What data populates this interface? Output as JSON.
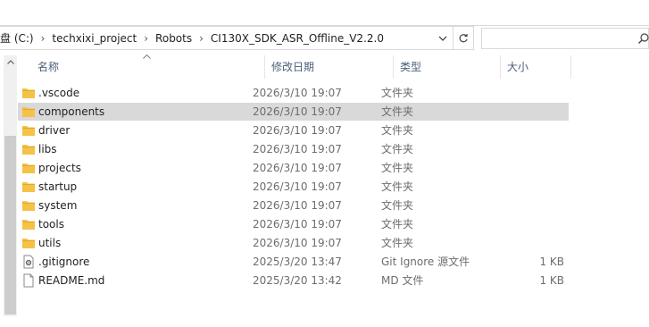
{
  "address": {
    "crumbs": [
      "盘 (C:)",
      "techxixi_project",
      "Robots",
      "CI130X_SDK_ASR_Offline_V2.2.0"
    ],
    "separator": "›"
  },
  "columns": {
    "name": "名称",
    "date": "修改日期",
    "type": "类型",
    "size": "大小"
  },
  "files": [
    {
      "name": ".vscode",
      "date": "2026/3/10 19:07",
      "type": "文件夹",
      "size": "",
      "icon": "folder-icon",
      "selected": false
    },
    {
      "name": "components",
      "date": "2026/3/10 19:07",
      "type": "文件夹",
      "size": "",
      "icon": "folder-icon",
      "selected": true
    },
    {
      "name": "driver",
      "date": "2026/3/10 19:07",
      "type": "文件夹",
      "size": "",
      "icon": "folder-icon",
      "selected": false
    },
    {
      "name": "libs",
      "date": "2026/3/10 19:07",
      "type": "文件夹",
      "size": "",
      "icon": "folder-icon",
      "selected": false
    },
    {
      "name": "projects",
      "date": "2026/3/10 19:07",
      "type": "文件夹",
      "size": "",
      "icon": "folder-icon",
      "selected": false
    },
    {
      "name": "startup",
      "date": "2026/3/10 19:07",
      "type": "文件夹",
      "size": "",
      "icon": "folder-icon",
      "selected": false
    },
    {
      "name": "system",
      "date": "2026/3/10 19:07",
      "type": "文件夹",
      "size": "",
      "icon": "folder-icon",
      "selected": false
    },
    {
      "name": "tools",
      "date": "2026/3/10 19:07",
      "type": "文件夹",
      "size": "",
      "icon": "folder-icon",
      "selected": false
    },
    {
      "name": "utils",
      "date": "2026/3/10 19:07",
      "type": "文件夹",
      "size": "",
      "icon": "folder-icon",
      "selected": false
    },
    {
      "name": ".gitignore",
      "date": "2025/3/20 13:47",
      "type": "Git Ignore 源文件",
      "size": "1 KB",
      "icon": "gear-file-icon",
      "selected": false
    },
    {
      "name": "README.md",
      "date": "2025/3/20 13:42",
      "type": "MD 文件",
      "size": "1 KB",
      "icon": "document-icon",
      "selected": false
    }
  ],
  "colors": {
    "selection": "#d9d9d9",
    "folder": "#f4c247",
    "header_text": "#4c607a"
  }
}
